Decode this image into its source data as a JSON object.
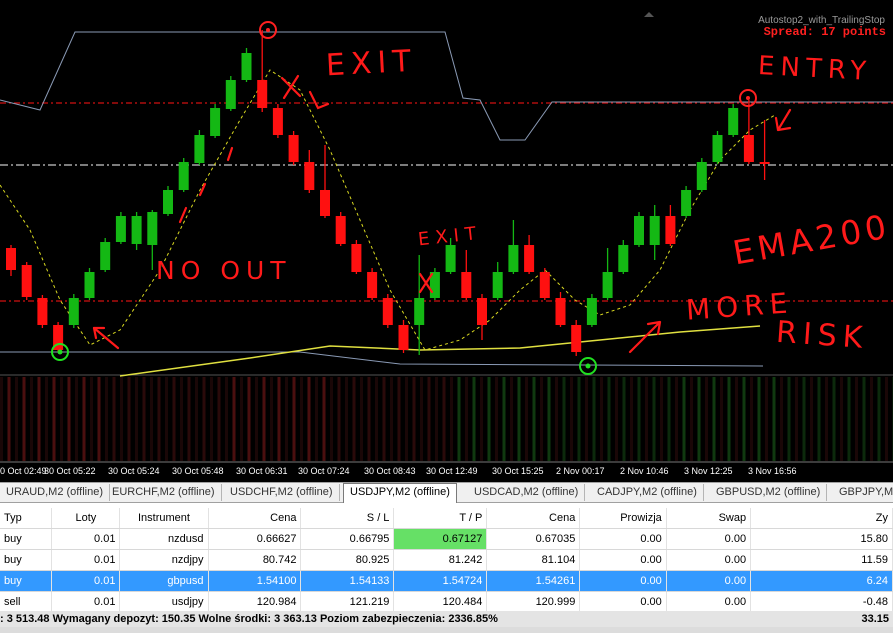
{
  "ea": {
    "name": "Autostop2_with_TrailingStop",
    "spread": "Spread: 17 points"
  },
  "annotations": {
    "exit_top": "EXIT",
    "entry": "ENTRY",
    "no_out": "NO OUT",
    "exit_mid": "EXIT",
    "ema": "EMA200",
    "more_risk_1": "MORE",
    "more_risk_2": "RISK"
  },
  "time_axis": [
    "0 Oct 02:49",
    "30 Oct 05:22",
    "30 Oct 05:24",
    "30 Oct 05:48",
    "30 Oct 06:31",
    "30 Oct 07:24",
    "30 Oct 08:43",
    "30 Oct 12:49",
    "30 Oct 15:25",
    "2 Nov 00:17",
    "2 Nov 10:46",
    "3 Nov 12:25",
    "3 Nov 16:56"
  ],
  "tabs": [
    "URAUD,M2 (offline)",
    "EURCHF,M2 (offline)",
    "USDCHF,M2 (offline)",
    "USDJPY,M2 (offline)",
    "USDCAD,M2 (offline)",
    "CADJPY,M2 (offline)",
    "GBPUSD,M2 (offline)",
    "GBPJPY,M2 ("
  ],
  "active_tab": "USDJPY,M2 (offline)",
  "table": {
    "headers": [
      "Typ",
      "Loty",
      "Instrument",
      "Cena",
      "S / L",
      "T / P",
      "Cena",
      "Prowizja",
      "Swap",
      "Zy"
    ],
    "rows": [
      [
        "buy",
        "0.01",
        "nzdusd",
        "0.66627",
        "0.66795",
        "0.67127",
        "0.67035",
        "0.00",
        "0.00",
        "15.80"
      ],
      [
        "buy",
        "0.01",
        "nzdjpy",
        "80.742",
        "80.925",
        "81.242",
        "81.104",
        "0.00",
        "0.00",
        "11.59"
      ],
      [
        "buy",
        "0.01",
        "gbpusd",
        "1.54100",
        "1.54133",
        "1.54724",
        "1.54261",
        "0.00",
        "0.00",
        "6.24"
      ],
      [
        "sell",
        "0.01",
        "usdjpy",
        "120.984",
        "121.219",
        "120.484",
        "120.999",
        "0.00",
        "0.00",
        "-0.48"
      ]
    ]
  },
  "summary": ": 3 513.48  Wymagany depozyt: 150.35  Wolne środki: 3 363.13  Poziom zabezpieczenia: 2336.85%",
  "summary_total": "33.15",
  "chart_data": {
    "candles": [
      {
        "d": "down",
        "o": 248,
        "c": 270,
        "h": 245,
        "l": 276
      },
      {
        "d": "down",
        "o": 265,
        "c": 297,
        "h": 262,
        "l": 300
      },
      {
        "d": "down",
        "o": 298,
        "c": 325,
        "h": 295,
        "l": 328
      },
      {
        "d": "down",
        "o": 325,
        "c": 350,
        "h": 322,
        "l": 352
      },
      {
        "d": "up",
        "o": 325,
        "c": 298,
        "h": 294,
        "l": 328
      },
      {
        "d": "up",
        "o": 298,
        "c": 272,
        "h": 268,
        "l": 300
      },
      {
        "d": "up",
        "o": 270,
        "c": 242,
        "h": 238,
        "l": 272
      },
      {
        "d": "up",
        "o": 242,
        "c": 216,
        "h": 212,
        "l": 244
      },
      {
        "d": "up",
        "o": 244,
        "c": 216,
        "h": 212,
        "l": 250
      },
      {
        "d": "up",
        "o": 245,
        "c": 212,
        "h": 210,
        "l": 270
      },
      {
        "d": "up",
        "o": 214,
        "c": 190,
        "h": 186,
        "l": 216
      },
      {
        "d": "up",
        "o": 190,
        "c": 162,
        "h": 158,
        "l": 192
      },
      {
        "d": "up",
        "o": 163,
        "c": 135,
        "h": 130,
        "l": 165
      },
      {
        "d": "up",
        "o": 136,
        "c": 108,
        "h": 104,
        "l": 138
      },
      {
        "d": "up",
        "o": 109,
        "c": 80,
        "h": 76,
        "l": 111
      },
      {
        "d": "up",
        "o": 80,
        "c": 53,
        "h": 48,
        "l": 82
      },
      {
        "d": "down",
        "o": 80,
        "c": 108,
        "h": 30,
        "l": 112
      },
      {
        "d": "down",
        "o": 108,
        "c": 135,
        "h": 104,
        "l": 138
      },
      {
        "d": "down",
        "o": 135,
        "c": 162,
        "h": 131,
        "l": 165
      },
      {
        "d": "down",
        "o": 162,
        "c": 190,
        "h": 150,
        "l": 193
      },
      {
        "d": "down",
        "o": 190,
        "c": 216,
        "h": 145,
        "l": 218
      },
      {
        "d": "down",
        "o": 216,
        "c": 244,
        "h": 212,
        "l": 246
      },
      {
        "d": "down",
        "o": 244,
        "c": 272,
        "h": 240,
        "l": 274
      },
      {
        "d": "down",
        "o": 272,
        "c": 298,
        "h": 268,
        "l": 300
      },
      {
        "d": "down",
        "o": 298,
        "c": 325,
        "h": 294,
        "l": 328
      },
      {
        "d": "down",
        "o": 325,
        "c": 350,
        "h": 320,
        "l": 353
      },
      {
        "d": "up",
        "o": 325,
        "c": 298,
        "h": 255,
        "l": 355
      },
      {
        "d": "up",
        "o": 298,
        "c": 272,
        "h": 268,
        "l": 300
      },
      {
        "d": "up",
        "o": 272,
        "c": 245,
        "h": 238,
        "l": 274
      },
      {
        "d": "down",
        "o": 272,
        "c": 298,
        "h": 250,
        "l": 300
      },
      {
        "d": "down",
        "o": 298,
        "c": 325,
        "h": 294,
        "l": 340
      },
      {
        "d": "up",
        "o": 298,
        "c": 272,
        "h": 262,
        "l": 300
      },
      {
        "d": "up",
        "o": 272,
        "c": 245,
        "h": 220,
        "l": 274
      },
      {
        "d": "down",
        "o": 245,
        "c": 272,
        "h": 235,
        "l": 274
      },
      {
        "d": "down",
        "o": 272,
        "c": 298,
        "h": 268,
        "l": 300
      },
      {
        "d": "down",
        "o": 298,
        "c": 325,
        "h": 292,
        "l": 327
      },
      {
        "d": "down",
        "o": 325,
        "c": 352,
        "h": 320,
        "l": 356
      },
      {
        "d": "up",
        "o": 325,
        "c": 298,
        "h": 294,
        "l": 327
      },
      {
        "d": "up",
        "o": 298,
        "c": 272,
        "h": 248,
        "l": 300
      },
      {
        "d": "up",
        "o": 272,
        "c": 245,
        "h": 240,
        "l": 274
      },
      {
        "d": "up",
        "o": 245,
        "c": 216,
        "h": 212,
        "l": 247
      },
      {
        "d": "up",
        "o": 245,
        "c": 216,
        "h": 205,
        "l": 260
      },
      {
        "d": "down",
        "o": 216,
        "c": 244,
        "h": 205,
        "l": 246
      },
      {
        "d": "up",
        "o": 216,
        "c": 190,
        "h": 186,
        "l": 218
      },
      {
        "d": "up",
        "o": 190,
        "c": 162,
        "h": 158,
        "l": 192
      },
      {
        "d": "up",
        "o": 162,
        "c": 135,
        "h": 131,
        "l": 164
      },
      {
        "d": "up",
        "o": 135,
        "c": 108,
        "h": 104,
        "l": 137
      },
      {
        "d": "down",
        "o": 135,
        "c": 162,
        "h": 100,
        "l": 164
      },
      {
        "d": "down",
        "o": 162,
        "c": 164,
        "h": 120,
        "l": 180
      }
    ]
  }
}
